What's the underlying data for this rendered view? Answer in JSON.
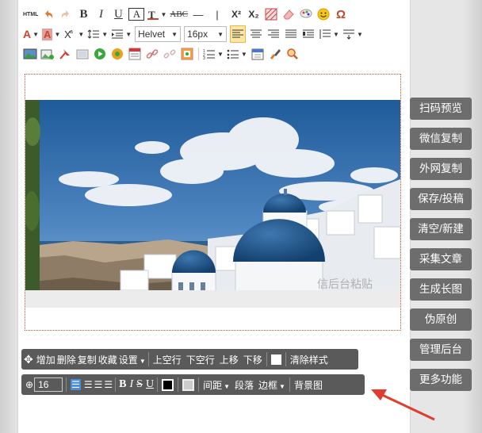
{
  "toolbar": {
    "row1": {
      "html_label": "HTML",
      "bold": "B",
      "italic": "I",
      "underline": "U",
      "font_color": "A",
      "strike_label": "ABC",
      "hr": "—",
      "pipe": "|",
      "sup": "X²",
      "sub": "X₂",
      "omega": "Ω"
    },
    "row2": {
      "font_family": "Helvet",
      "font_size": "16px"
    }
  },
  "editor": {
    "watermark": "信后台粘贴"
  },
  "float_bar_1": {
    "add": "增加",
    "delete": "删除",
    "copy": "复制",
    "favorite": "收藏",
    "settings": "设置",
    "up_line": "上空行",
    "down_line": "下空行",
    "move_up": "上移",
    "move_down": "下移",
    "clear_style": "清除样式"
  },
  "float_bar_2": {
    "value": "16",
    "bold": "B",
    "italic": "I",
    "strike": "S",
    "underline": "U",
    "spacing": "间距",
    "paragraph": "段落",
    "border": "边框",
    "background_image": "背景图"
  },
  "sidebar": {
    "items": [
      {
        "label": "扫码预览"
      },
      {
        "label": "微信复制"
      },
      {
        "label": "外网复制"
      },
      {
        "label": "保存/投稿"
      },
      {
        "label": "清空/新建"
      },
      {
        "label": "采集文章"
      },
      {
        "label": "生成长图"
      },
      {
        "label": "伪原创"
      },
      {
        "label": "管理后台"
      },
      {
        "label": "更多功能"
      }
    ]
  },
  "colors": {
    "sidebar_bg": "#6d6d6d",
    "toolbar_dark": "#5a5a5a",
    "arrow": "#e03c2f",
    "accent": "#c8462c"
  }
}
